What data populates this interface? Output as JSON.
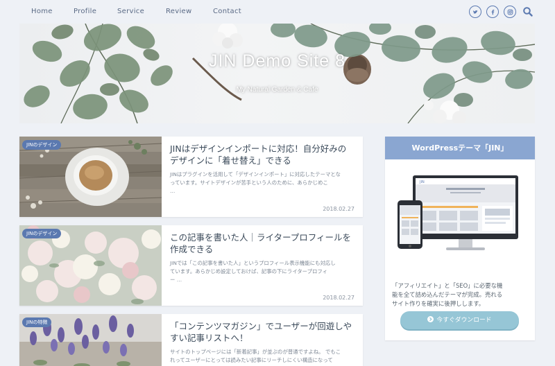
{
  "nav": {
    "items": [
      "Home",
      "Profile",
      "Service",
      "Review",
      "Contact"
    ]
  },
  "social": [
    "twitter-icon",
    "facebook-icon",
    "instagram-icon",
    "search-icon"
  ],
  "hero": {
    "title": "JIN Demo Site 8",
    "subtitle": "My Natural Garden & Cafe"
  },
  "articles": [
    {
      "badge": "JINのデザイン",
      "title_line1": "JINはデザインインポートに対応！自分好みの",
      "title_line2": "デザインに「着せ替え」できる",
      "excerpt_line1": "JINはプラグインを活用して「デザインインポート」に対応したテーマとな",
      "excerpt_line2": "っています。サイトデザインが苦手という人のために、あらかじめこ",
      "excerpt_line3": "…",
      "date": "2018.02.27"
    },
    {
      "badge": "JINのデザイン",
      "title_line1": "この記事を書いた人｜ライタープロフィールを",
      "title_line2": "作成できる",
      "excerpt_line1": "JINでは「この記事を書いた人」というプロフィール表示機能にも対応し",
      "excerpt_line2": "ています。あらかじめ設定しておけば、記事の下にライタープロフィ",
      "excerpt_line3": "ー …",
      "date": "2018.02.27"
    },
    {
      "badge": "JINの特徴",
      "title_line1": "「コンテンツマガジン」でユーザーが回遊しや",
      "title_line2": "すい記事リストへ！",
      "excerpt_line1": "サイトのトップページには「新着記事」が並ぶのが普通ですよね。 でもこ",
      "excerpt_line2": "れってユーザーにとっては読みたい記事にリーチしにくい構造になって",
      "excerpt_line3": "",
      "date": ""
    }
  ],
  "sidebar": {
    "widget_title": "WordPressテーマ「JIN」",
    "mock_logo": "JIN",
    "text_line1": "「アフィリエイト」と「SEO」に必要な機",
    "text_line2": "能を全て詰め込んだテーマが完成。売れる",
    "text_line3": "サイト作りを確実に後押しします。",
    "button_label": "今すぐダウンロード"
  },
  "colors": {
    "accent": "#5b79b0",
    "widget_header": "#8aa6d1",
    "button": "#96c6d6",
    "background": "#eef1f6"
  }
}
